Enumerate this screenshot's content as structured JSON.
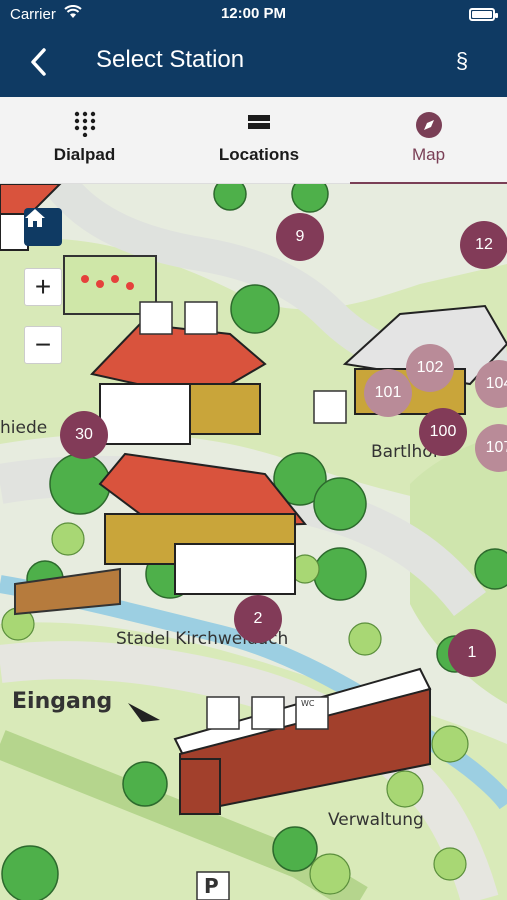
{
  "status_bar": {
    "carrier": "Carrier",
    "time": "12:00 PM"
  },
  "nav": {
    "title": "Select Station",
    "right_symbol": "§"
  },
  "tabs": [
    {
      "label": "Dialpad",
      "icon": "dialpad-icon"
    },
    {
      "label": "Locations",
      "icon": "list-icon"
    },
    {
      "label": "Map",
      "icon": "compass-icon",
      "active": true
    }
  ],
  "map": {
    "zoom_in": "+",
    "zoom_out": "−",
    "labels": {
      "schmiede": "hiede",
      "bartlhof": "Bartlhof",
      "stadel": "Stadel Kirchweidach",
      "eingang": "Eingang",
      "verwaltung": "Verwaltung",
      "parking": "P",
      "wc": "WC"
    },
    "stations": [
      {
        "id": "9",
        "style": "dark"
      },
      {
        "id": "12",
        "style": "dark"
      },
      {
        "id": "102",
        "style": "light"
      },
      {
        "id": "104",
        "style": "light"
      },
      {
        "id": "101",
        "style": "light"
      },
      {
        "id": "100",
        "style": "dark"
      },
      {
        "id": "107",
        "style": "light"
      },
      {
        "id": "30",
        "style": "dark"
      },
      {
        "id": "2",
        "style": "dark"
      },
      {
        "id": "1",
        "style": "dark"
      }
    ]
  },
  "colors": {
    "header": "#0f3a63",
    "accent": "#7a3f56",
    "pin_dark": "#823b58",
    "pin_light": "#b98b98"
  }
}
